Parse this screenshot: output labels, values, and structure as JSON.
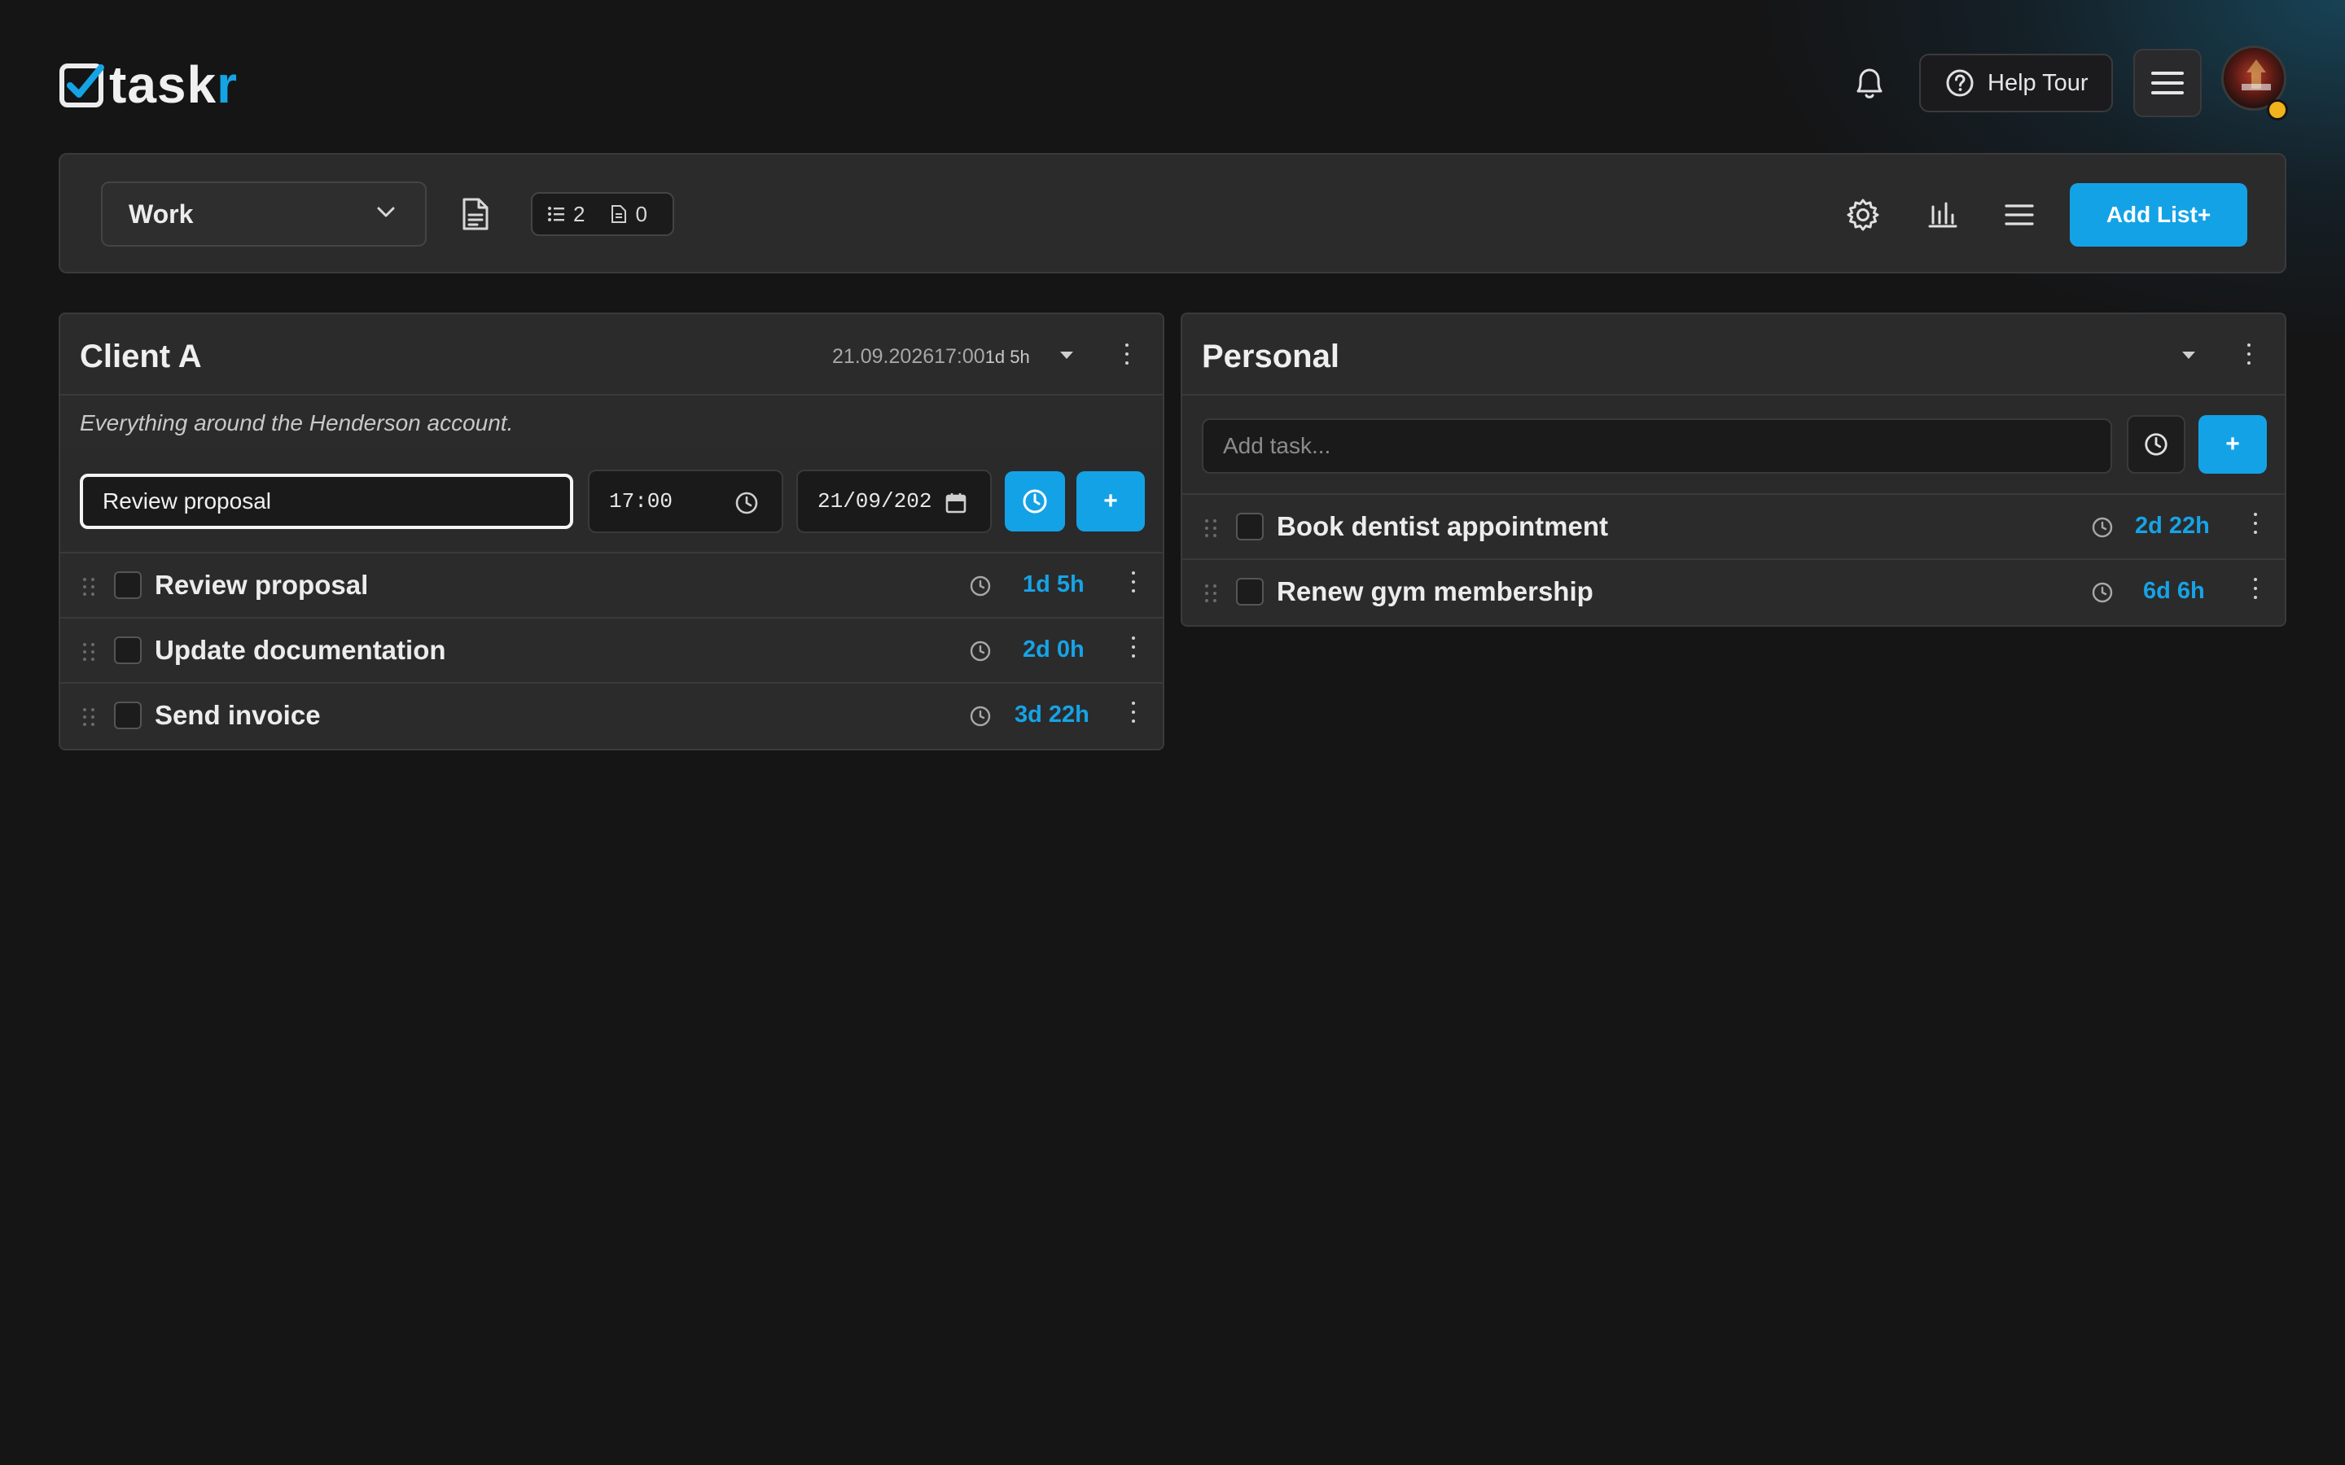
{
  "app": {
    "logo_text": "task",
    "logo_accent": "r",
    "accent_color": "#14a2e6"
  },
  "header": {
    "help_label": "Help Tour",
    "icons": [
      "bell-icon",
      "help-circle-icon",
      "hamburger-menu-icon",
      "avatar"
    ]
  },
  "toolbar": {
    "board_name": "Work",
    "lists_count": "2",
    "notes_count": "0",
    "add_list_label": "Add List+",
    "icons": [
      "document-icon",
      "settings-gear-icon",
      "bar-chart-icon",
      "list-menu-icon"
    ]
  },
  "lists": [
    {
      "title": "Client A",
      "deadline_date": "21.09.2026",
      "deadline_time": "17:00",
      "deadline_remaining": "1d 5h",
      "description": "Everything around the Henderson account.",
      "add_task_value": "Review proposal",
      "time_value": "17:00",
      "date_value": "21/09/202",
      "tasks": [
        {
          "label": "Review proposal",
          "remaining": "1d 5h",
          "done": false
        },
        {
          "label": "Update documentation",
          "remaining": "2d 0h",
          "done": false
        },
        {
          "label": "Send invoice",
          "remaining": "3d 22h",
          "done": false
        }
      ]
    },
    {
      "title": "Personal",
      "add_task_placeholder": "Add task...",
      "tasks": [
        {
          "label": "Book dentist appointment",
          "remaining": "2d 22h",
          "done": false
        },
        {
          "label": "Renew gym membership",
          "remaining": "6d 6h",
          "done": false
        }
      ]
    }
  ]
}
